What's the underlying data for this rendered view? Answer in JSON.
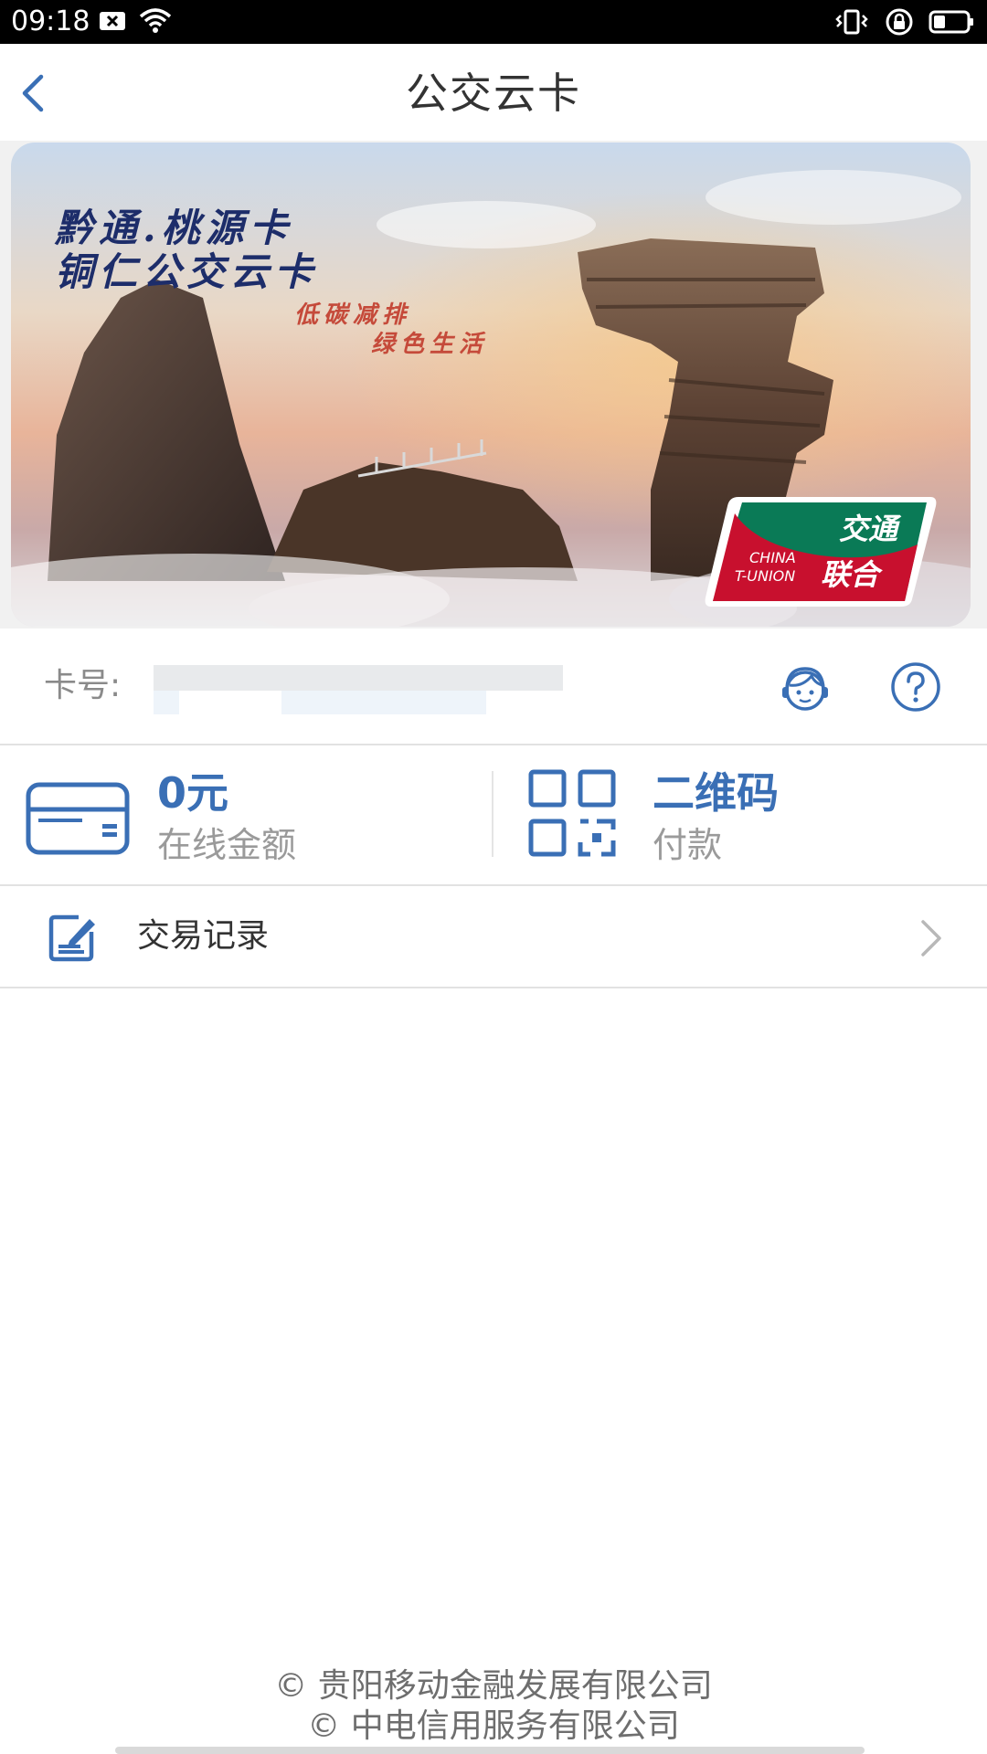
{
  "status_bar": {
    "time": "09:18",
    "icons_left": [
      "notification-x-icon",
      "wifi-icon"
    ],
    "icons_right": [
      "vibrate-icon",
      "rotation-lock-icon",
      "battery-icon"
    ]
  },
  "header": {
    "title": "公交云卡",
    "back_icon": "chevron-left-icon"
  },
  "card": {
    "title_line1": "黔通.桃源卡",
    "title_line2": "铜仁公交云卡",
    "slogan_line1": "低碳减排",
    "slogan_line2": "绿色生活",
    "badge_cn": "交通联合",
    "badge_en": "CHINA T-UNION",
    "colors": {
      "badge_green": "#0a7a56",
      "badge_red": "#c8102e",
      "title_blue": "#1d2d6a",
      "slogan_red": "#c54a3a"
    }
  },
  "card_number": {
    "label": "卡号:",
    "value_masked": true,
    "service_icon": "customer-service-icon",
    "help_icon": "help-circle-icon"
  },
  "actions": {
    "balance": {
      "value": "0元",
      "label": "在线金额",
      "icon": "card-icon"
    },
    "qr": {
      "title": "二维码",
      "label": "付款",
      "icon": "qr-code-icon"
    }
  },
  "records": {
    "label": "交易记录",
    "icon": "edit-note-icon",
    "chevron_icon": "chevron-right-icon"
  },
  "footer": {
    "line1": "© 贵阳移动金融发展有限公司",
    "line2": "© 中电信用服务有限公司"
  },
  "theme": {
    "accent": "#3a6fb5",
    "text_primary": "#333333",
    "text_secondary": "#9a9a9a",
    "divider": "#e2e2e2"
  }
}
